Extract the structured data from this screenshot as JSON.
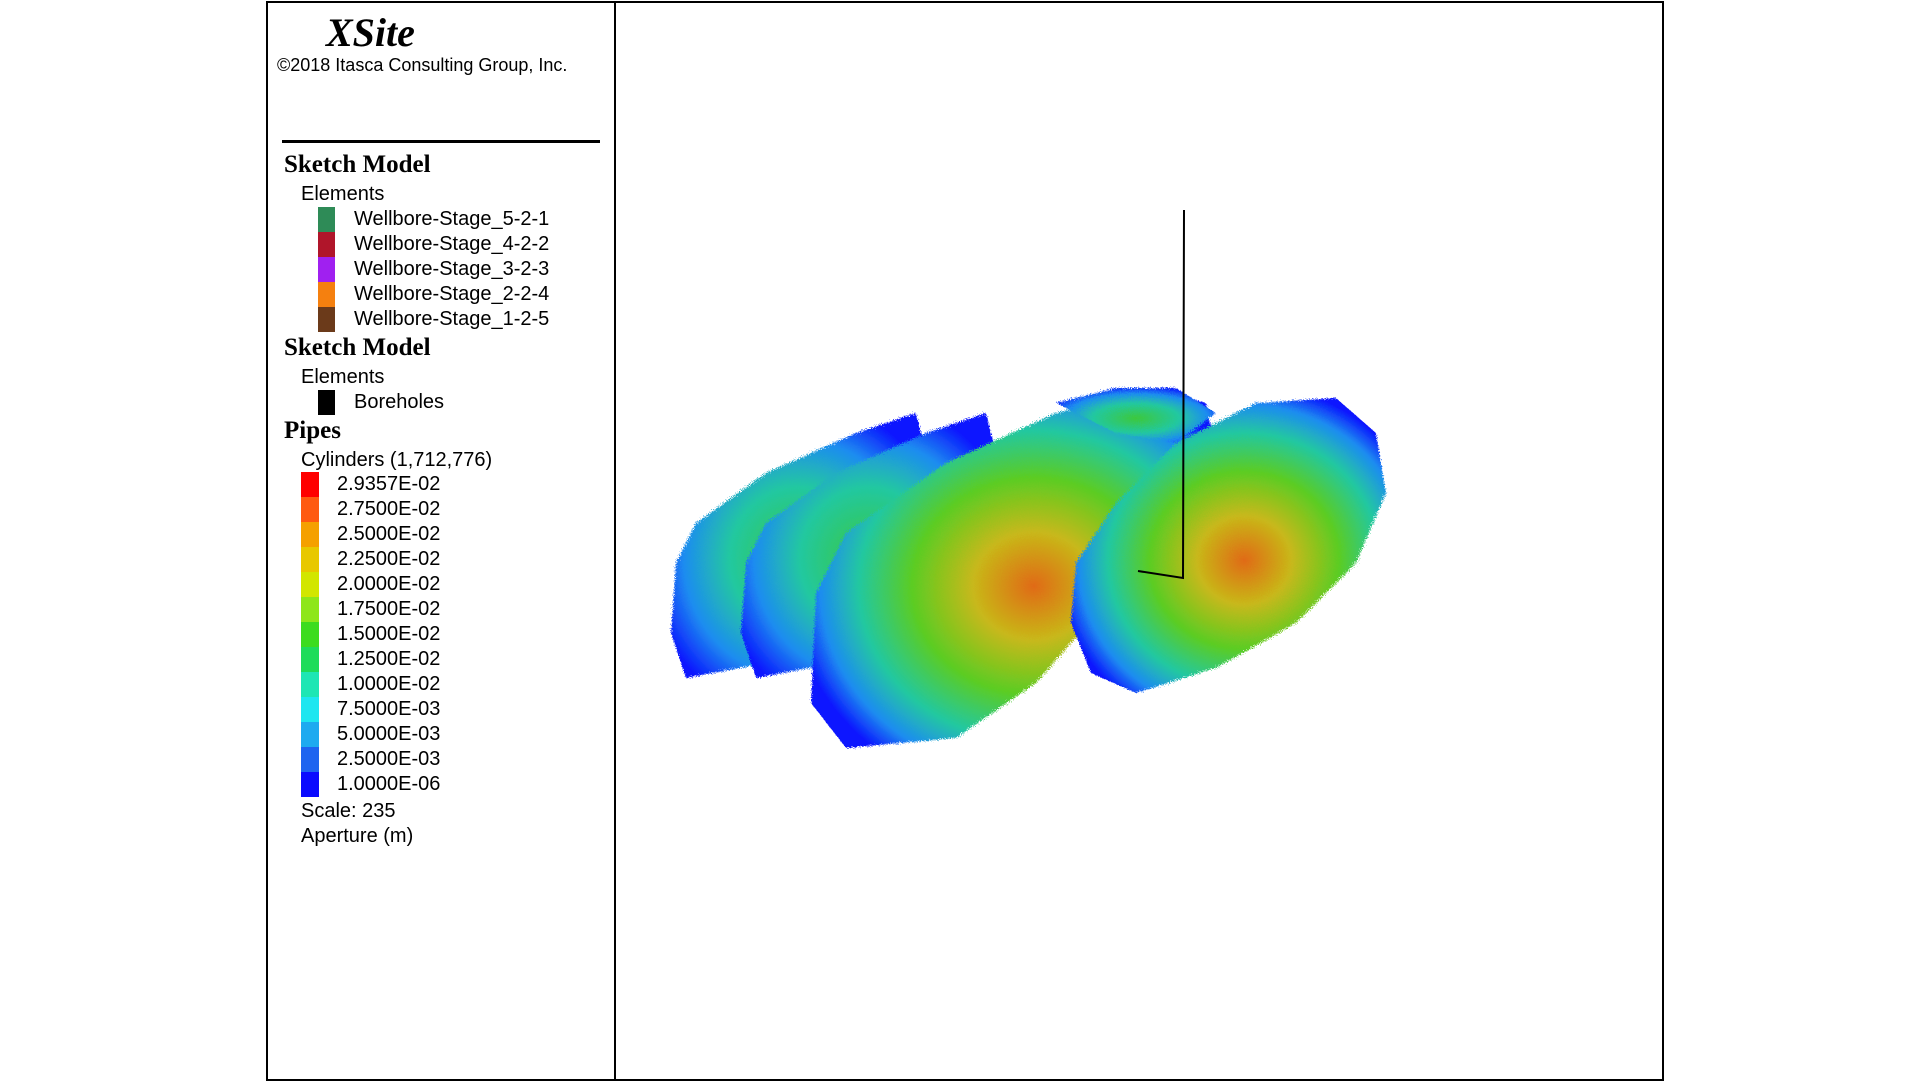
{
  "header": {
    "app_title": "XSite",
    "copyright": "©2018 Itasca Consulting Group, Inc."
  },
  "legend": {
    "sections": [
      {
        "title": "Sketch Model",
        "subtitle": "Elements",
        "items": [
          {
            "label": "Wellbore-Stage_5-2-1",
            "color": "#2e8b57"
          },
          {
            "label": "Wellbore-Stage_4-2-2",
            "color": "#b0152a"
          },
          {
            "label": "Wellbore-Stage_3-2-3",
            "color": "#a020f0"
          },
          {
            "label": "Wellbore-Stage_2-2-4",
            "color": "#f5800f"
          },
          {
            "label": "Wellbore-Stage_1-2-5",
            "color": "#6b3a1a"
          }
        ]
      },
      {
        "title": "Sketch Model",
        "subtitle": "Elements",
        "items": [
          {
            "label": "Boreholes",
            "color": "#000000"
          }
        ]
      }
    ],
    "pipes": {
      "title": "Pipes",
      "subtitle": "Cylinders (1,712,776)",
      "ramp": [
        {
          "label": "2.9357E-02",
          "color": "#ff0000"
        },
        {
          "label": "2.7500E-02",
          "color": "#ff5a10"
        },
        {
          "label": "2.5000E-02",
          "color": "#f5a000"
        },
        {
          "label": "2.2500E-02",
          "color": "#e8c800"
        },
        {
          "label": "2.0000E-02",
          "color": "#d2e600"
        },
        {
          "label": "1.7500E-02",
          "color": "#8ee61a"
        },
        {
          "label": "1.5000E-02",
          "color": "#3cdc1e"
        },
        {
          "label": "1.2500E-02",
          "color": "#1edc5a"
        },
        {
          "label": "1.0000E-02",
          "color": "#1ee6b4"
        },
        {
          "label": "7.5000E-03",
          "color": "#1ee6f0"
        },
        {
          "label": "5.0000E-03",
          "color": "#1eaaf0"
        },
        {
          "label": "2.5000E-03",
          "color": "#1e64f0"
        },
        {
          "label": "1.0000E-06",
          "color": "#0a0aff"
        }
      ],
      "scale_label": "Scale: 235",
      "quantity_label": "Aperture (m)"
    }
  }
}
